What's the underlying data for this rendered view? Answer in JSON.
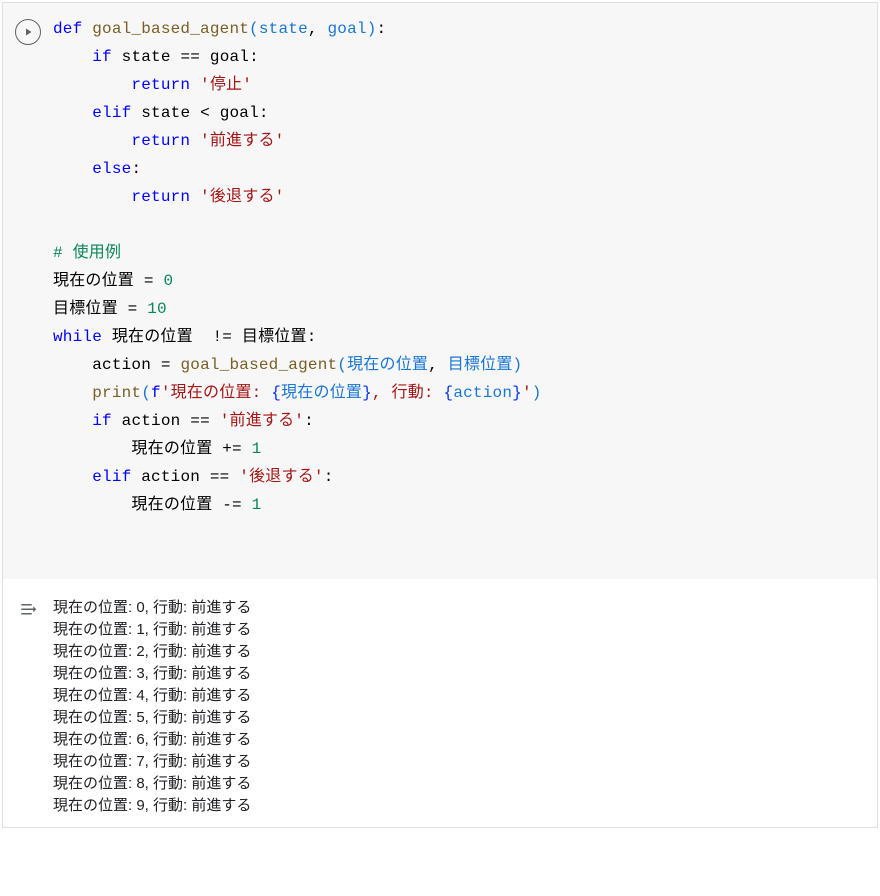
{
  "code": {
    "l1": {
      "k_def": "def",
      "fn": "goal_based_agent",
      "p1": "state",
      "p2": "goal"
    },
    "l2": {
      "k_if": "if",
      "v_state": "state",
      "op": "==",
      "v_goal": "goal"
    },
    "l3": {
      "k_return": "return",
      "s": "'停止'"
    },
    "l4": {
      "k_elif": "elif",
      "v_state": "state",
      "op": "<",
      "v_goal": "goal"
    },
    "l5": {
      "k_return": "return",
      "s": "'前進する'"
    },
    "l6": {
      "k_else": "else"
    },
    "l7": {
      "k_return": "return",
      "s": "'後退する'"
    },
    "l9": {
      "cm": "# 使用例"
    },
    "l10": {
      "lhs": "現在の位置",
      "op": "=",
      "rhs": "0"
    },
    "l11": {
      "lhs": "目標位置",
      "op": "=",
      "rhs": "10"
    },
    "l12": {
      "k_while": "while",
      "a": "現在の位置",
      "op": "!=",
      "b": "目標位置"
    },
    "l13": {
      "lhs": "action",
      "op": "=",
      "fn": "goal_based_agent",
      "a": "現在の位置",
      "b": "目標位置"
    },
    "l14": {
      "print": "print",
      "fpf": "f",
      "s1": "'現在の位置: ",
      "e1": "現在の位置",
      "s2": ", 行動: ",
      "e2": "action",
      "s3": "'"
    },
    "l15": {
      "k_if": "if",
      "a": "action",
      "op": "==",
      "s": "'前進する'"
    },
    "l16": {
      "lhs": "現在の位置",
      "op": "+=",
      "rhs": "1"
    },
    "l17": {
      "k_elif": "elif",
      "a": "action",
      "op": "==",
      "s": "'後退する'"
    },
    "l18": {
      "lhs": "現在の位置",
      "op": "-=",
      "rhs": "1"
    }
  },
  "output": [
    "現在の位置: 0, 行動: 前進する",
    "現在の位置: 1, 行動: 前進する",
    "現在の位置: 2, 行動: 前進する",
    "現在の位置: 3, 行動: 前進する",
    "現在の位置: 4, 行動: 前進する",
    "現在の位置: 5, 行動: 前進する",
    "現在の位置: 6, 行動: 前進する",
    "現在の位置: 7, 行動: 前進する",
    "現在の位置: 8, 行動: 前進する",
    "現在の位置: 9, 行動: 前進する"
  ]
}
